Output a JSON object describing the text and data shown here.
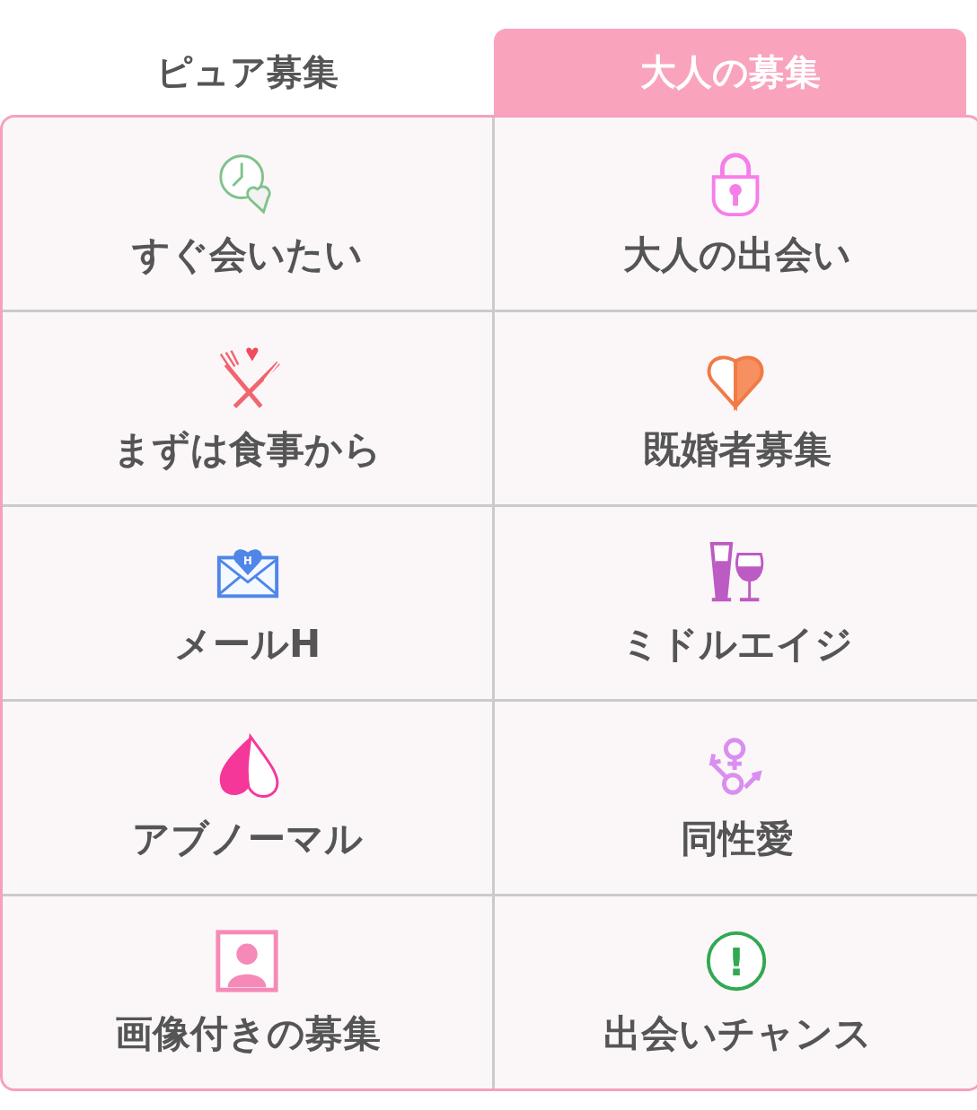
{
  "tabs": [
    {
      "label": "ピュア募集",
      "selected": false
    },
    {
      "label": "大人の募集",
      "selected": true
    }
  ],
  "rows": [
    {
      "cells": [
        {
          "label": "すぐ会いたい",
          "kind": "clock-heart"
        },
        {
          "label": "大人の出会い",
          "kind": "lock"
        }
      ]
    },
    {
      "cells": [
        {
          "label": "まずは食事から",
          "kind": "dinner"
        },
        {
          "label": "既婚者募集",
          "kind": "half-heart"
        }
      ]
    },
    {
      "cells": [
        {
          "label": "メールH",
          "kind": "mail",
          "badge": "H"
        },
        {
          "label": "ミドルエイジ",
          "kind": "glasses"
        }
      ]
    },
    {
      "cells": [
        {
          "label": "アブノーマル",
          "kind": "drop"
        },
        {
          "label": "同性愛",
          "kind": "gender"
        }
      ]
    },
    {
      "cells": [
        {
          "label": "画像付きの募集",
          "kind": "portrait"
        },
        {
          "label": "出会いチャンス",
          "kind": "chance",
          "badge": "!"
        }
      ]
    }
  ]
}
